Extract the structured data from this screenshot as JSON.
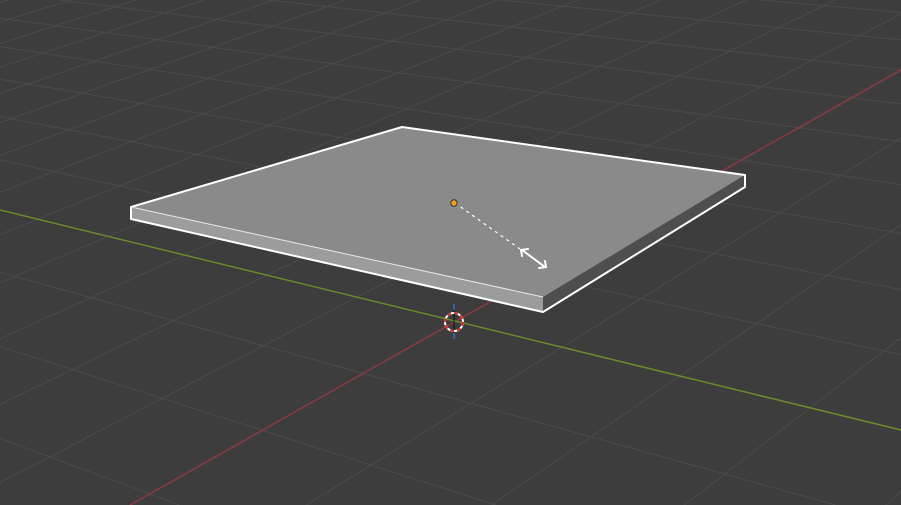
{
  "viewport": {
    "background_color": "#3d3d3d",
    "grid_color": "#4b4b4b",
    "x_axis_color": "#8a3a40",
    "y_axis_color": "#6a8a2c",
    "object": {
      "type": "scaled box",
      "top_color": "#8a8a8a",
      "front_color": "#9c9c9c",
      "side_color": "#4e4e4e",
      "outline_color": "#ffffff",
      "origin_color": "#f0a020"
    },
    "tool": {
      "mode": "scale",
      "cursor_icon": "scale-arrows-icon"
    },
    "cursor_3d_icon": "3d-cursor-icon"
  }
}
